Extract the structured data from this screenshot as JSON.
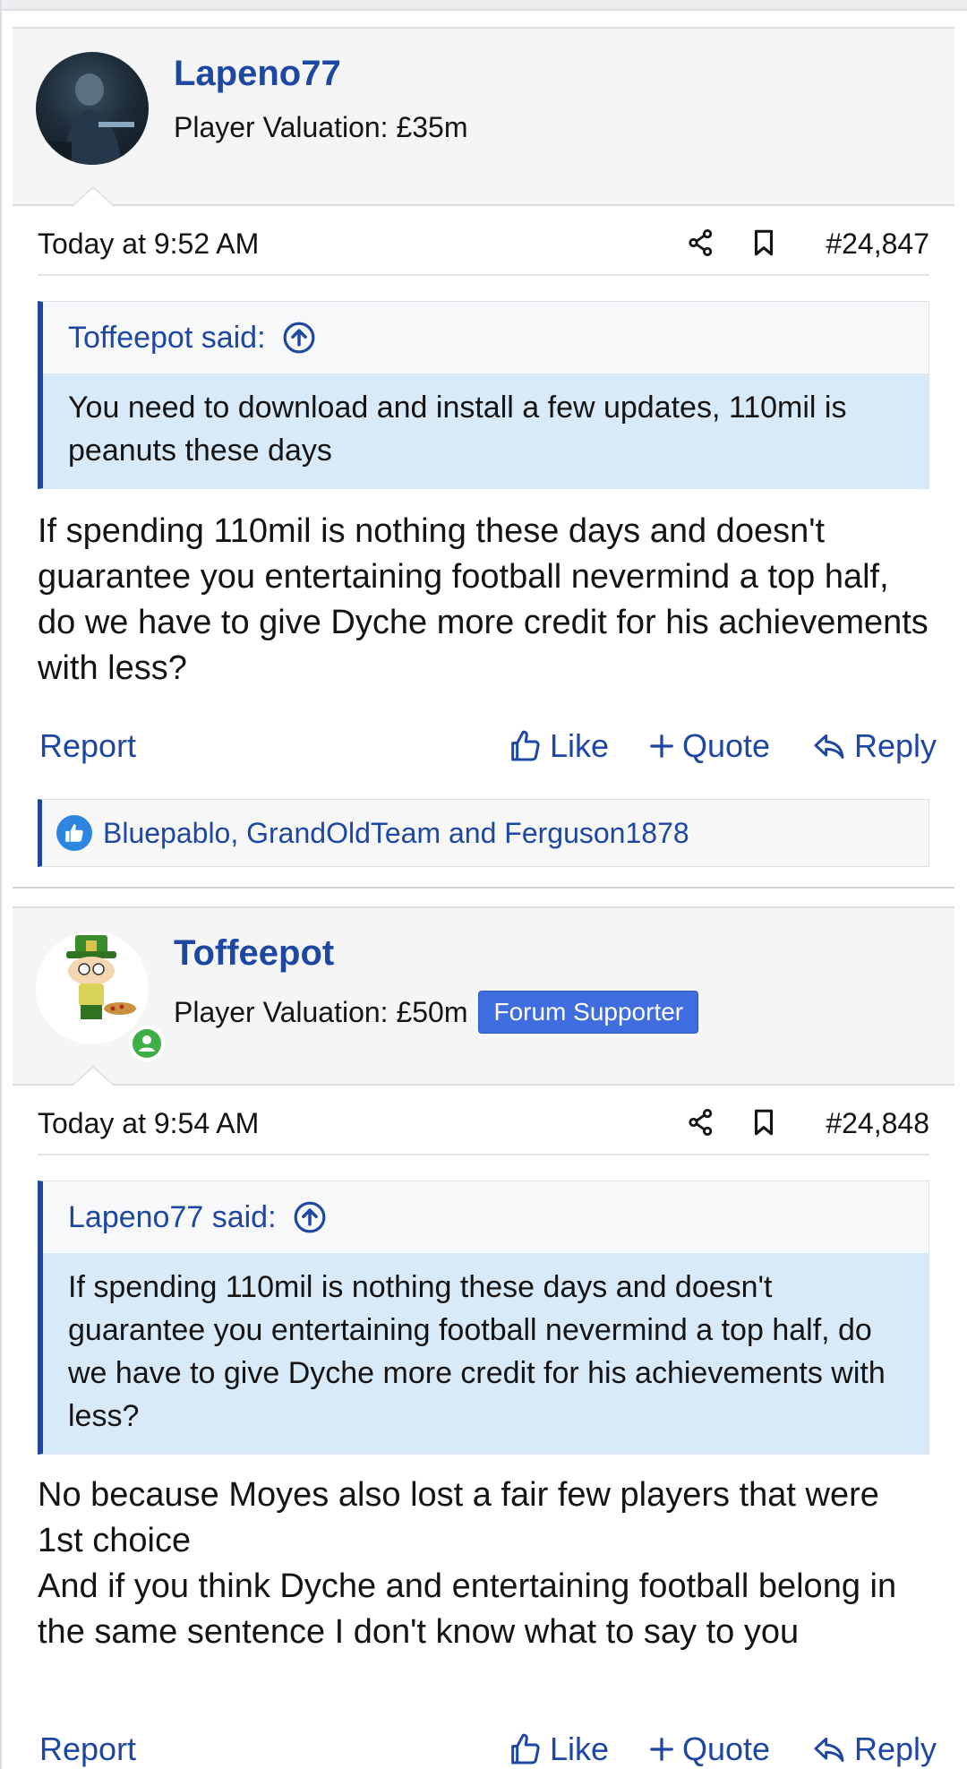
{
  "posts": [
    {
      "username": "Lapeno77",
      "valuation": "Player Valuation: £35m",
      "badge": "",
      "date": "Today at 9:52 AM",
      "post_number": "#24,847",
      "quote_author": "Toffeepot said:",
      "quote_text": "You need to download and install a few updates, 110mil is peanuts these days",
      "message": "If spending 110mil is nothing these days and doesn't guarantee you entertaining football nevermind a top half, do we have to give Dyche more credit for his achievements with less?",
      "likes": "Bluepablo, GrandOldTeam and Ferguson1878"
    },
    {
      "username": "Toffeepot",
      "valuation": "Player Valuation: £50m",
      "badge": "Forum Supporter",
      "date": "Today at 9:54 AM",
      "post_number": "#24,848",
      "quote_author": "Lapeno77 said:",
      "quote_text": "If spending 110mil is nothing these days and doesn't guarantee you entertaining football nevermind a top half, do we have to give Dyche more credit for his achievements with less?",
      "message_lines": [
        "No because Moyes also lost a fair few players that were 1st choice",
        "And if you think Dyche and entertaining football belong in the same sentence I don't know what to say to you"
      ]
    }
  ],
  "actions": {
    "report": "Report",
    "like": "Like",
    "quote": "Quote",
    "reply": "Reply"
  },
  "colors": {
    "link": "#1d47a0",
    "quote_bg": "#d8e9f7",
    "badge_bg": "#3f6de0",
    "online": "#3fae46"
  }
}
